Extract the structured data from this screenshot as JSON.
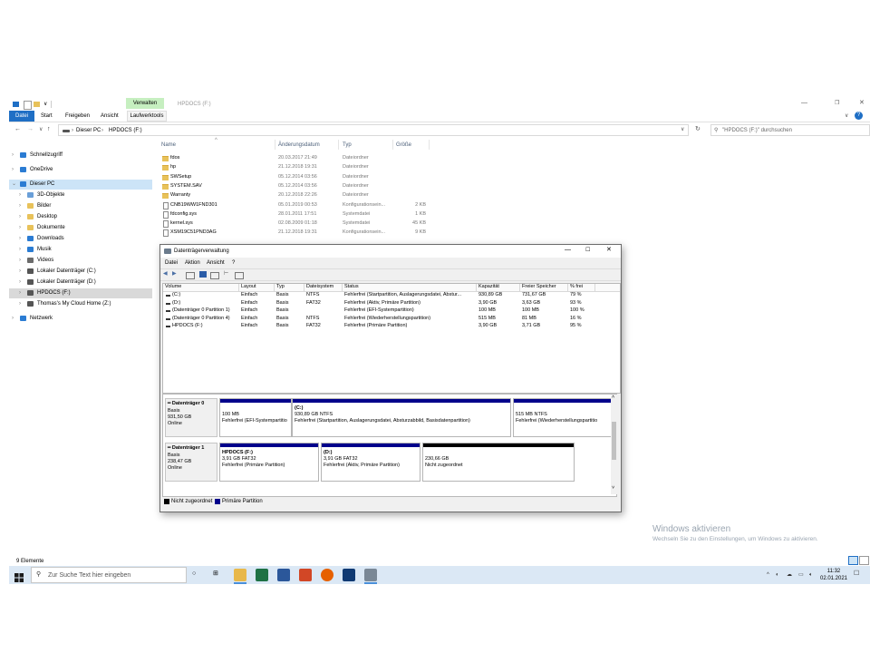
{
  "ribbon": {
    "context_tab": "Verwalten",
    "window_title": "HPDOCS (F:)",
    "tabs": [
      "Datei",
      "Start",
      "Freigeben",
      "Ansicht",
      "Laufwerktools"
    ]
  },
  "address": {
    "path": [
      "Dieser PC",
      "HPDOCS (F:)"
    ],
    "search_placeholder": "\"HPDOCS (F:)\" durchsuchen"
  },
  "nav": {
    "items": [
      {
        "label": "Schnellzugriff",
        "level": 0
      },
      {
        "label": "OneDrive",
        "level": 0
      },
      {
        "label": "Dieser PC",
        "level": 0
      },
      {
        "label": "3D-Objekte",
        "level": 1
      },
      {
        "label": "Bilder",
        "level": 1
      },
      {
        "label": "Desktop",
        "level": 1
      },
      {
        "label": "Dokumente",
        "level": 1
      },
      {
        "label": "Downloads",
        "level": 1
      },
      {
        "label": "Musik",
        "level": 1
      },
      {
        "label": "Videos",
        "level": 1
      },
      {
        "label": "Lokaler Datenträger (C:)",
        "level": 1
      },
      {
        "label": "Lokaler Datenträger (D:)",
        "level": 1
      },
      {
        "label": "HPDOCS (F:)",
        "level": 1
      },
      {
        "label": "Thomas's My Cloud Home (Z:)",
        "level": 1
      },
      {
        "label": "Netzwerk",
        "level": 0
      }
    ]
  },
  "files": {
    "headers": [
      "Name",
      "Änderungsdatum",
      "Typ",
      "Größe"
    ],
    "rows": [
      {
        "name": "fdos",
        "date": "20.03.2017 21:49",
        "type": "Dateiordner",
        "size": "",
        "kind": "folder"
      },
      {
        "name": "hp",
        "date": "21.12.2018 19:31",
        "type": "Dateiordner",
        "size": "",
        "kind": "folder"
      },
      {
        "name": "SWSetup",
        "date": "05.12.2014 03:56",
        "type": "Dateiordner",
        "size": "",
        "kind": "folder"
      },
      {
        "name": "SYSTEM.SAV",
        "date": "05.12.2014 03:56",
        "type": "Dateiordner",
        "size": "",
        "kind": "folder"
      },
      {
        "name": "Warranty",
        "date": "20.12.2018 22:26",
        "type": "Dateiordner",
        "size": "",
        "kind": "folder"
      },
      {
        "name": "CNB19WW1FND301",
        "date": "05.01.2019 00:53",
        "type": "Konfigurationsein...",
        "size": "2 KB",
        "kind": "file"
      },
      {
        "name": "fdconfig.sys",
        "date": "28.01.2011 17:51",
        "type": "Systemdatei",
        "size": "1 KB",
        "kind": "file"
      },
      {
        "name": "kernel.sys",
        "date": "02.08.2009 01:18",
        "type": "Systemdatei",
        "size": "45 KB",
        "kind": "file"
      },
      {
        "name": "XSM19C51PND3AG",
        "date": "21.12.2018 19:31",
        "type": "Konfigurationsein...",
        "size": "9 KB",
        "kind": "file"
      }
    ]
  },
  "status": {
    "items_count": "9 Elemente"
  },
  "diskmgmt": {
    "title": "Datenträgerverwaltung",
    "menu": [
      "Datei",
      "Aktion",
      "Ansicht",
      "?"
    ],
    "headers": [
      "Volume",
      "Layout",
      "Typ",
      "Dateisystem",
      "Status",
      "Kapazität",
      "Freier Speicher",
      "% frei"
    ],
    "volumes": [
      [
        "(C:)",
        "Einfach",
        "Basis",
        "NTFS",
        "Fehlerfrei (Startpartition, Auslagerungsdatei, Abstur...",
        "930,89 GB",
        "731,67 GB",
        "79 %"
      ],
      [
        "(D:)",
        "Einfach",
        "Basis",
        "FAT32",
        "Fehlerfrei (Aktiv, Primäre Partition)",
        "3,90 GB",
        "3,63 GB",
        "93 %"
      ],
      [
        "(Datenträger 0 Partition 1)",
        "Einfach",
        "Basis",
        "",
        "Fehlerfrei (EFI-Systempartition)",
        "100 MB",
        "100 MB",
        "100 %"
      ],
      [
        "(Datenträger 0 Partition 4)",
        "Einfach",
        "Basis",
        "NTFS",
        "Fehlerfrei (Wiederherstellungspartition)",
        "515 MB",
        "81 MB",
        "16 %"
      ],
      [
        "HPDOCS (F:)",
        "Einfach",
        "Basis",
        "FAT32",
        "Fehlerfrei (Primäre Partition)",
        "3,90 GB",
        "3,71 GB",
        "95 %"
      ]
    ],
    "disks": [
      {
        "name": "Datenträger 0",
        "type": "Basis",
        "size": "931,50 GB",
        "state": "Online",
        "partitions": [
          {
            "title": "",
            "line1": "100 MB",
            "line2": "Fehlerfrei (EFI-Systempartitio",
            "bar": "blue"
          },
          {
            "title": "(C:)",
            "line1": "930,89 GB NTFS",
            "line2": "Fehlerfrei (Startpartition, Auslagerungsdatei, Absturzabbild, Basisdatenpartition)",
            "bar": "blue"
          },
          {
            "title": "",
            "line1": "515 MB NTFS",
            "line2": "Fehlerfrei (Wiederherstellungspartitio",
            "bar": "blue"
          }
        ]
      },
      {
        "name": "Datenträger 1",
        "type": "Basis",
        "size": "238,47 GB",
        "state": "Online",
        "partitions": [
          {
            "title": "HPDOCS (F:)",
            "line1": "3,91 GB FAT32",
            "line2": "Fehlerfrei (Primäre Partition)",
            "bar": "blue"
          },
          {
            "title": "(D:)",
            "line1": "3,91 GB FAT32",
            "line2": "Fehlerfrei (Aktiv, Primäre Partition)",
            "bar": "blue"
          },
          {
            "title": "",
            "line1": "230,66 GB",
            "line2": "Nicht zugeordnet",
            "bar": "black"
          }
        ]
      }
    ],
    "legend": [
      "Nicht zugeordnet",
      "Primäre Partition"
    ]
  },
  "watermark": {
    "title": "Windows aktivieren",
    "subtitle": "Wechseln Sie zu den Einstellungen, um Windows zu aktivieren."
  },
  "taskbar": {
    "search_placeholder": "Zur Suche Text hier eingeben",
    "time": "11:32",
    "date": "02.01.2021"
  },
  "colors": {
    "accent": "#1f6fc5",
    "primary_partition": "#00008b",
    "unallocated": "#000000",
    "context_tab": "#c6efc0"
  }
}
